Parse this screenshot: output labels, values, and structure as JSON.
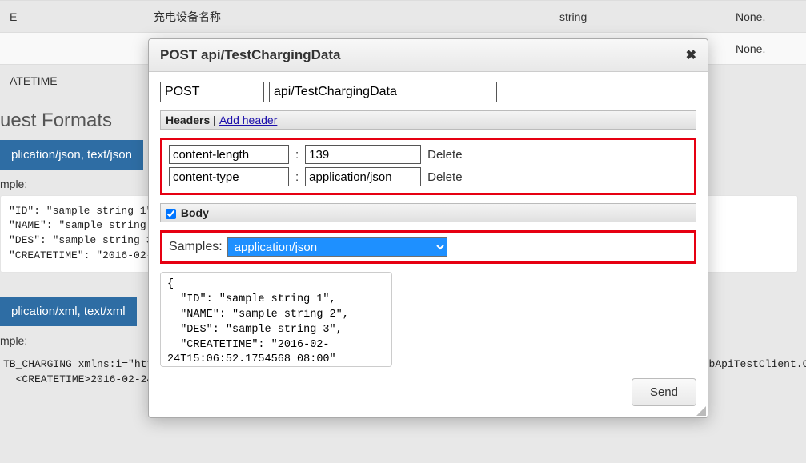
{
  "background": {
    "row1": {
      "cols": [
        "E",
        "充电设备名称",
        "string",
        "None."
      ]
    },
    "row2": {
      "cols": [
        "",
        "",
        "",
        "None."
      ]
    },
    "row3": {
      "cols": [
        "ATETIME",
        "",
        "",
        ""
      ]
    },
    "heading": "uest Formats",
    "tab_json": "plication/json, text/json",
    "mple": "mple:",
    "json_block": "\"ID\": \"sample string 1\",\n\"NAME\": \"sample string 2\n\"DES\": \"sample string 3\"\n\"CREATETIME\": \"2016-02-24",
    "tab_xml": "plication/xml, text/xml",
    "xml_block": "TB_CHARGING xmlns:i=\"http://www.w3.org/2001/XMLSchema-instance\" xmlns=\"http://schemas.datacontract.org/2004/07/WebApiTestClient.Controllers\">\n  <CREATETIME>2016-02-24T15:06:52.1754568+08:00</CREATETIME>"
  },
  "modal": {
    "title": "POST api/TestChargingData",
    "verb_value": "POST",
    "path_value": "api/TestChargingData",
    "headers_label": "Headers",
    "add_header_label": "Add header",
    "headers": [
      {
        "key": "content-length",
        "value": "139",
        "delete": "Delete"
      },
      {
        "key": "content-type",
        "value": "application/json",
        "delete": "Delete"
      }
    ],
    "body_label": "Body",
    "body_checked": true,
    "samples_label": "Samples:",
    "samples_selected": "application/json",
    "body_text": "{\n  \"ID\": \"sample string 1\",\n  \"NAME\": \"sample string 2\",\n  \"DES\": \"sample string 3\",\n  \"CREATETIME\": \"2016-02-24T15:06:52.1754568 08:00\"",
    "send_label": "Send"
  }
}
